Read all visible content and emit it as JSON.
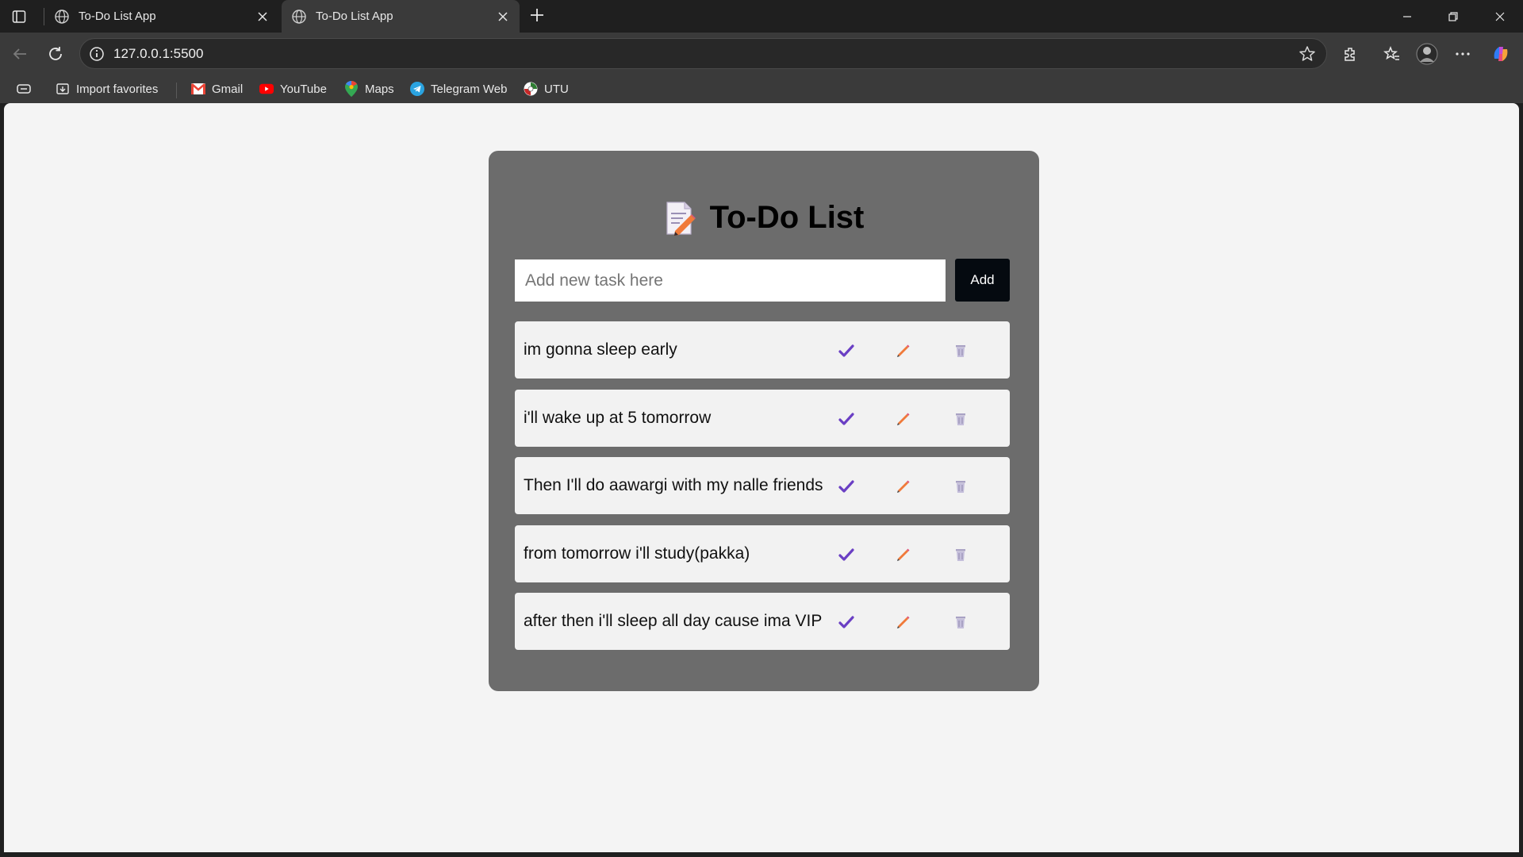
{
  "browser": {
    "tabs": [
      {
        "title": "To-Do List App",
        "active": false
      },
      {
        "title": "To-Do List App",
        "active": true
      }
    ],
    "url": "127.0.0.1:5500",
    "bookmarks": [
      {
        "label": "Import favorites",
        "icon": "import-icon"
      },
      {
        "label": "Gmail",
        "icon": "gmail-icon"
      },
      {
        "label": "YouTube",
        "icon": "youtube-icon"
      },
      {
        "label": "Maps",
        "icon": "maps-icon"
      },
      {
        "label": "Telegram Web",
        "icon": "telegram-icon"
      },
      {
        "label": "UTU",
        "icon": "utu-icon"
      }
    ]
  },
  "app": {
    "title": "To-Do List",
    "input_placeholder": "Add new task here",
    "add_label": "Add",
    "tasks": [
      {
        "text": "im gonna sleep early"
      },
      {
        "text": "i'll wake up at 5 tomorrow"
      },
      {
        "text": "Then I'll do aawargi with my nalle friends"
      },
      {
        "text": "from tomorrow i'll study(pakka)"
      },
      {
        "text": "after then i'll sleep all day cause ima VIP"
      }
    ]
  },
  "colors": {
    "card": "#6c6c6c",
    "page_bg": "#f4f4f4",
    "check": "#6a3fc4",
    "edit": "#f07a3a",
    "delete": "#a9a2c4",
    "add_button": "#050a10"
  }
}
